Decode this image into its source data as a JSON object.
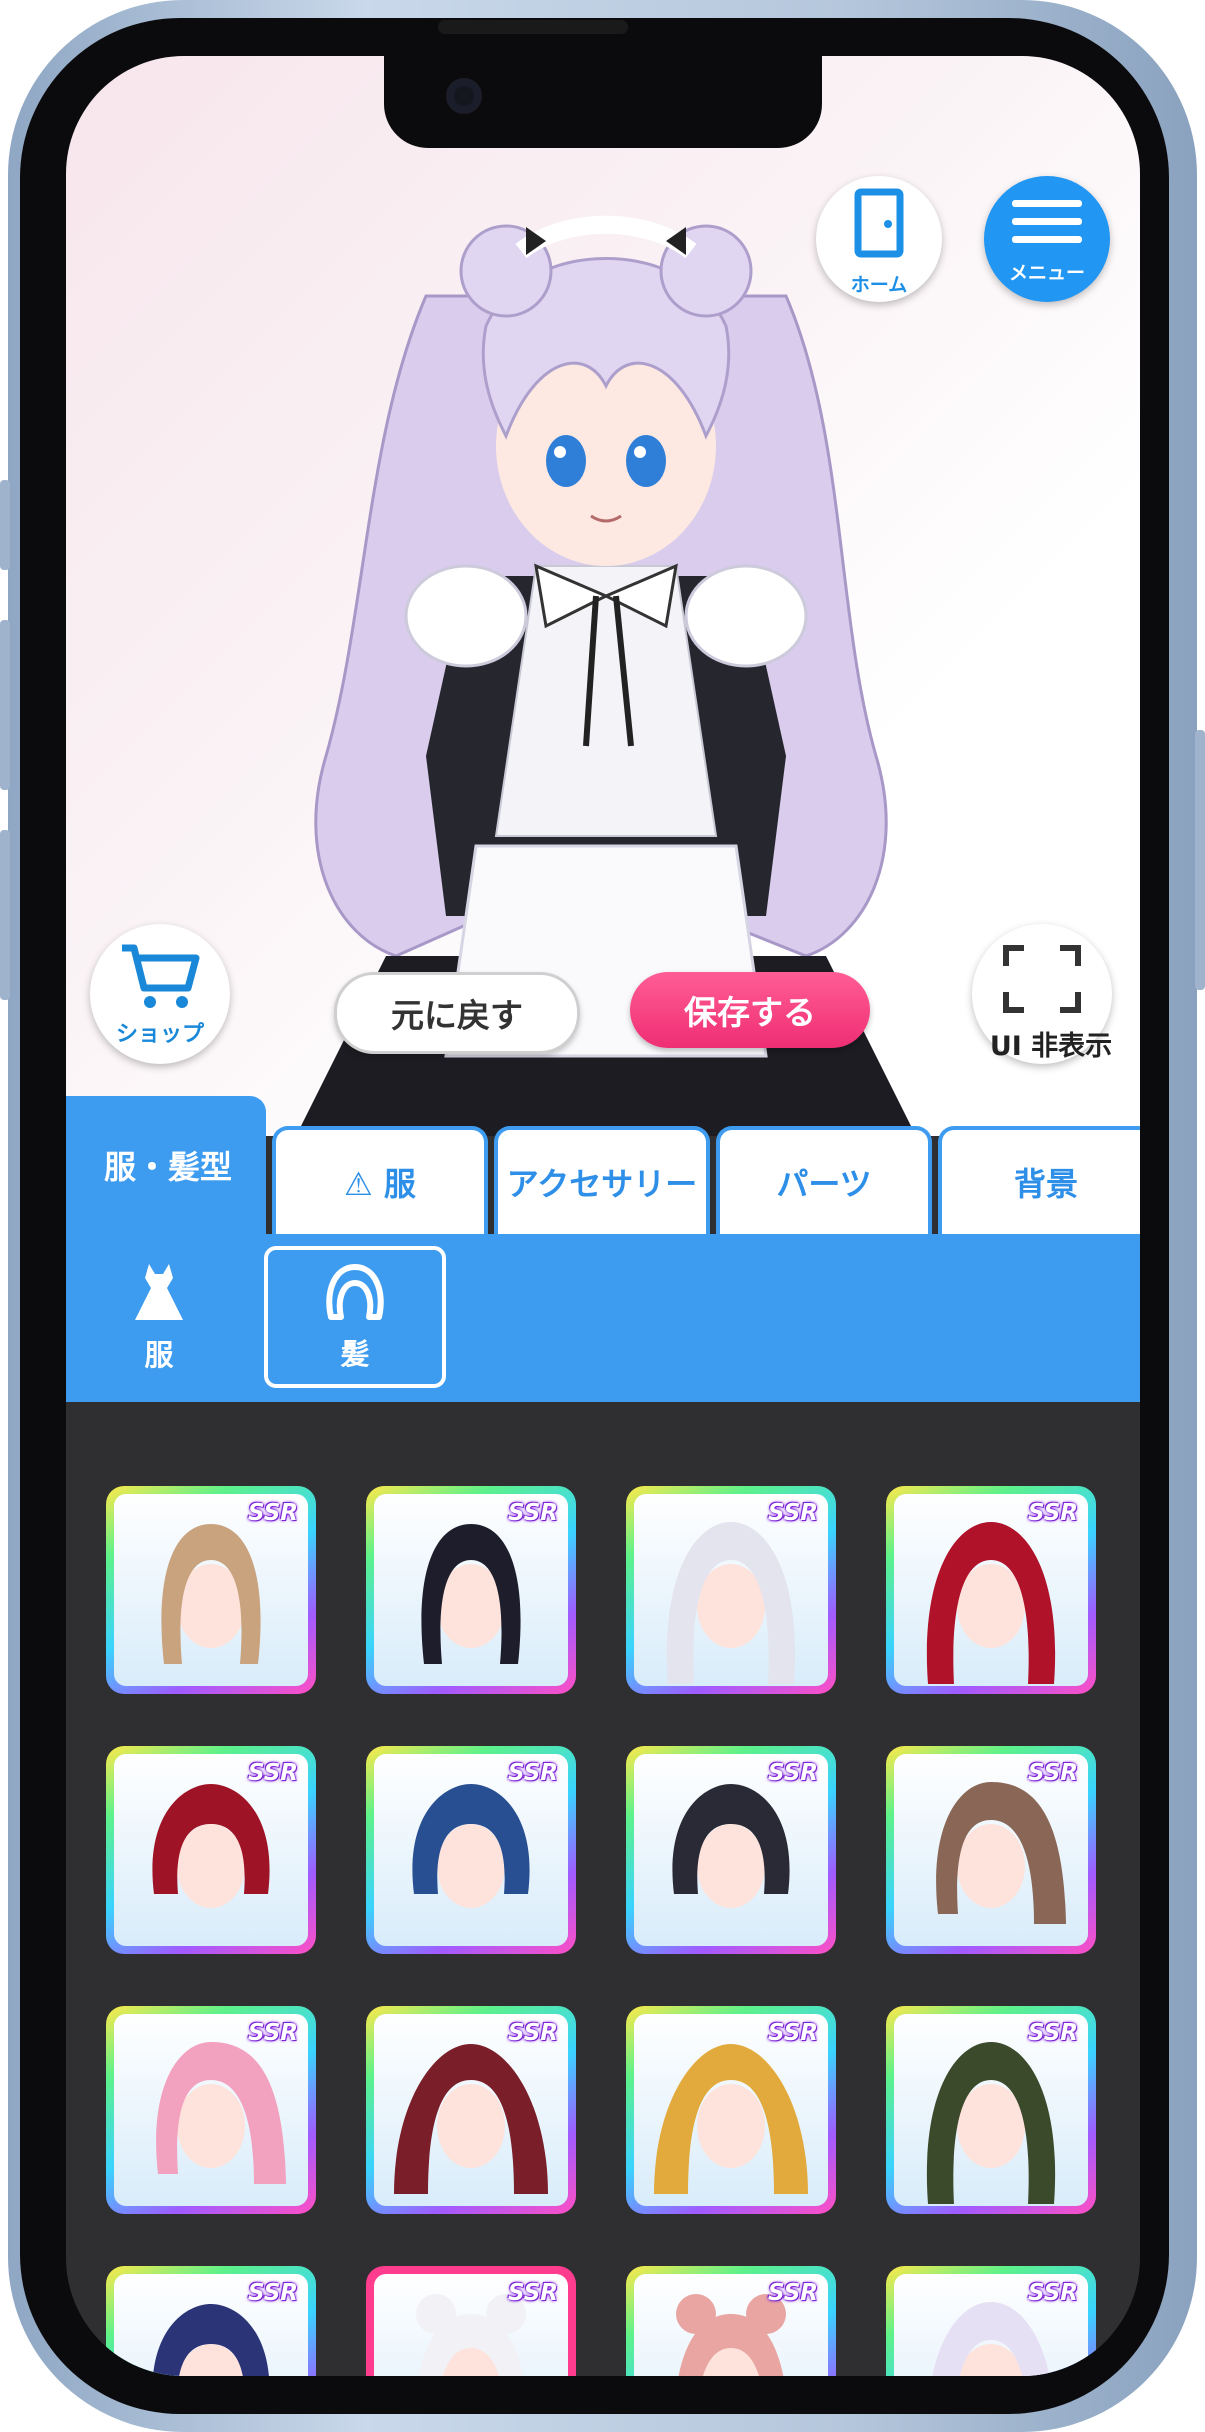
{
  "header": {
    "home_label": "ホーム",
    "menu_label": "メニュー"
  },
  "actions": {
    "shop_label": "ショップ",
    "revert_label": "元に戻す",
    "save_label": "保存する",
    "hide_ui_label": "UI 非表示"
  },
  "tabs": [
    {
      "label": "服・髪型",
      "active": true
    },
    {
      "label": "⚠ 服",
      "active": false
    },
    {
      "label": "アクセサリー",
      "active": false
    },
    {
      "label": "パーツ",
      "active": false
    },
    {
      "label": "背景",
      "active": false
    }
  ],
  "subtabs": [
    {
      "label": "服",
      "icon": "dress-icon",
      "selected": false
    },
    {
      "label": "髪",
      "icon": "hair-icon",
      "selected": true
    }
  ],
  "items": [
    {
      "rarity": "SSR",
      "hair": "#c9a27e",
      "style": "braids"
    },
    {
      "rarity": "SSR",
      "hair": "#1d1d2b",
      "style": "braids"
    },
    {
      "rarity": "SSR",
      "hair": "#e4e4ee",
      "style": "long"
    },
    {
      "rarity": "SSR",
      "hair": "#b0122a",
      "style": "wavy"
    },
    {
      "rarity": "SSR",
      "hair": "#9e1426",
      "style": "bob"
    },
    {
      "rarity": "SSR",
      "hair": "#284f92",
      "style": "bob"
    },
    {
      "rarity": "SSR",
      "hair": "#2a2a36",
      "style": "bob"
    },
    {
      "rarity": "SSR",
      "hair": "#8a6656",
      "style": "side"
    },
    {
      "rarity": "SSR",
      "hair": "#f2a2bf",
      "style": "side"
    },
    {
      "rarity": "SSR",
      "hair": "#7a1f2a",
      "style": "twin"
    },
    {
      "rarity": "SSR",
      "hair": "#e2aa3c",
      "style": "twin"
    },
    {
      "rarity": "SSR",
      "hair": "#3c4a2c",
      "style": "shag"
    },
    {
      "rarity": "SSR",
      "hair": "#2c3478",
      "style": "bob"
    },
    {
      "rarity": "SSR",
      "hair": "#f1f1f6",
      "style": "bun"
    },
    {
      "rarity": "SSR",
      "hair": "#e8a5a2",
      "style": "bun"
    },
    {
      "rarity": "SSR",
      "hair": "#e6e0f4",
      "style": "long"
    }
  ],
  "colors": {
    "accent_blue": "#3e9cf0",
    "save_pink": "#ef2e73",
    "grid_background": "#2f2f31"
  }
}
